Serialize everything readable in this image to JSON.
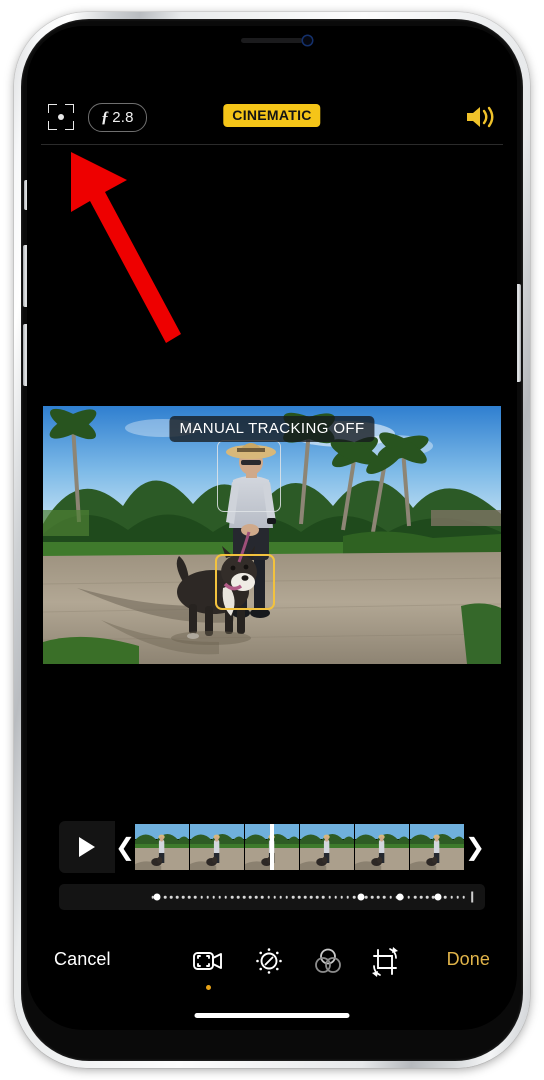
{
  "device": {
    "frame_color": "#e3e5e7",
    "screen_background": "#000000"
  },
  "topbar": {
    "tracking_icon_name": "focus-tracking-icon",
    "aperture": {
      "f_glyph": "ƒ",
      "value": "2.8"
    },
    "mode_badge": {
      "label": "CINEMATIC",
      "background": "#f5c518",
      "text_color": "#141414"
    },
    "audio_icon_name": "speaker-wave-icon",
    "audio_icon_color": "#f0c22a"
  },
  "annotation": {
    "type": "arrow",
    "color": "#ee0000",
    "points_to": "focus-tracking-icon"
  },
  "preview": {
    "status_badge": "MANUAL TRACKING OFF",
    "tracking_boxes": [
      {
        "subject": "person",
        "color": "#e1e4e8",
        "active": false
      },
      {
        "subject": "dog",
        "color": "#f2c23e",
        "active": true
      }
    ]
  },
  "scrubber": {
    "play_button_label": "play-icon",
    "left_handle": "❮",
    "right_handle": "❯",
    "frame_count": 6,
    "playhead_position_percent": 41
  },
  "depth_slider": {
    "small_dot_count": 52,
    "keyframe_positions_percent": [
      23,
      71,
      80,
      89
    ],
    "end_tick_position_percent": 97
  },
  "toolbar": {
    "cancel_label": "Cancel",
    "done_label": "Done",
    "done_color": "#e2b54a",
    "tools": [
      {
        "name": "cinematic-video-icon",
        "active": true
      },
      {
        "name": "adjust-dial-icon",
        "active": false
      },
      {
        "name": "filters-icon",
        "active": false
      },
      {
        "name": "crop-rotate-icon",
        "active": false
      }
    ],
    "active_indicator_color": "#e8a317"
  },
  "home_indicator": {
    "color": "#ffffff"
  }
}
